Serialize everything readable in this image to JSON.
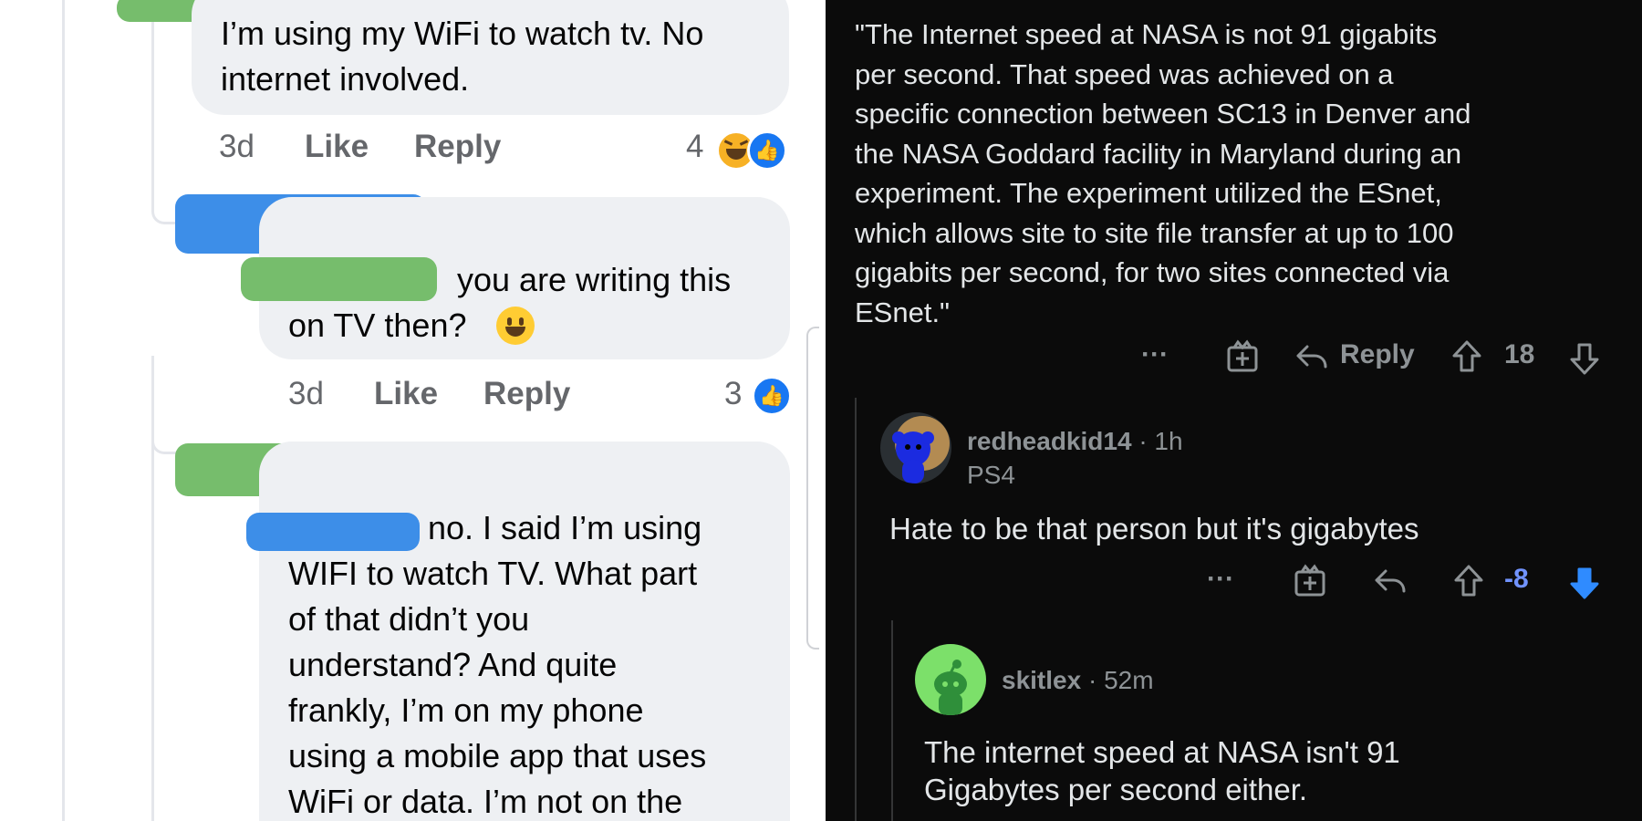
{
  "facebook": {
    "comment1": {
      "text_line1": "I’m using my WiFi to watch tv. No",
      "text_line2": "internet involved.",
      "time": "3d",
      "like": "Like",
      "reply": "Reply",
      "reaction_count": "4"
    },
    "comment2": {
      "text_line1": "you are writing this",
      "text_line2": "on TV then?",
      "time": "3d",
      "like": "Like",
      "reply": "Reply",
      "reaction_count": "3"
    },
    "comment3": {
      "lines": [
        "no. I said I’m using",
        "WIFI to watch TV. What part",
        "of that didn’t you",
        "understand? And quite",
        "frankly, I’m on my phone",
        "using a mobile app that uses",
        "WiFi or data. I’m not on the"
      ]
    },
    "colors": {
      "bubble": "#eef0f3",
      "meta": "#65676b",
      "like_blue": "#1877f2"
    }
  },
  "reddit": {
    "quote_lines": [
      "\"The Internet speed at NASA is not 91 gigabits",
      "per second. That speed was achieved on a",
      "specific connection between SC13 in Denver and",
      "the NASA Goddard facility in Maryland during an",
      "experiment. The experiment utilized the ESnet,",
      "which allows site to site file transfer at up to 100",
      "gigabits per second, for two sites connected via",
      "ESnet.\""
    ],
    "actions1": {
      "more": "···",
      "reply": "Reply",
      "score": "18"
    },
    "comment1": {
      "username": "redheadkid14",
      "sep": "·",
      "time": "1h",
      "flair": "PS4",
      "text": "Hate to be that person but it's gigabytes",
      "more": "···",
      "score": "-8"
    },
    "comment2": {
      "username": "skitlex",
      "sep": "·",
      "time": "52m",
      "text_line1": "The internet speed at NASA isn't 91",
      "text_line2": "Gigabytes per second either."
    },
    "colors": {
      "background": "#0b0b0b",
      "text": "#e3e6e8",
      "muted": "#8e9396",
      "score_negative": "#7193ff"
    }
  }
}
